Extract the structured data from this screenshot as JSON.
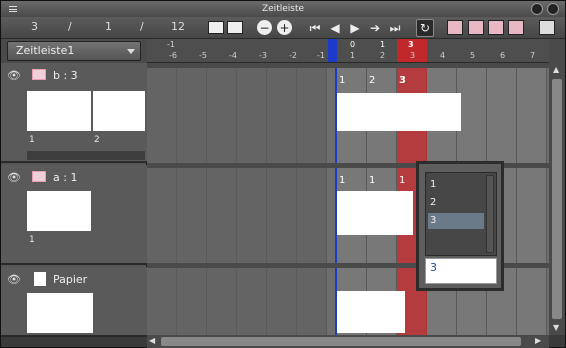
{
  "window": {
    "title": "Zeitleiste"
  },
  "toolbar": {
    "current_frame": "3",
    "sep1": "/",
    "range_start": "1",
    "sep2": "/",
    "range_end": "12"
  },
  "header": {
    "timeline_name": "Zeitleiste1"
  },
  "ruler": {
    "upper": [
      "-1",
      "0",
      "1",
      "3"
    ],
    "lower": [
      "-6",
      "-5",
      "-4",
      "-3",
      "-2",
      "-1",
      "1",
      "2",
      "3",
      "4",
      "5",
      "6",
      "7"
    ]
  },
  "layers": [
    {
      "name": "b : 3",
      "cells": [
        "1",
        "2"
      ],
      "frame_labels": [
        "1",
        "2",
        "3"
      ]
    },
    {
      "name": "a : 1",
      "cells": [
        "1"
      ],
      "frame_labels": [
        "1",
        "1",
        "1"
      ]
    },
    {
      "name": "Papier"
    }
  ],
  "popup": {
    "items": [
      "1",
      "2",
      "3"
    ],
    "input_value": "3"
  },
  "colors": {
    "playhead": "#c0282c",
    "start_marker": "#1a3cc8"
  }
}
